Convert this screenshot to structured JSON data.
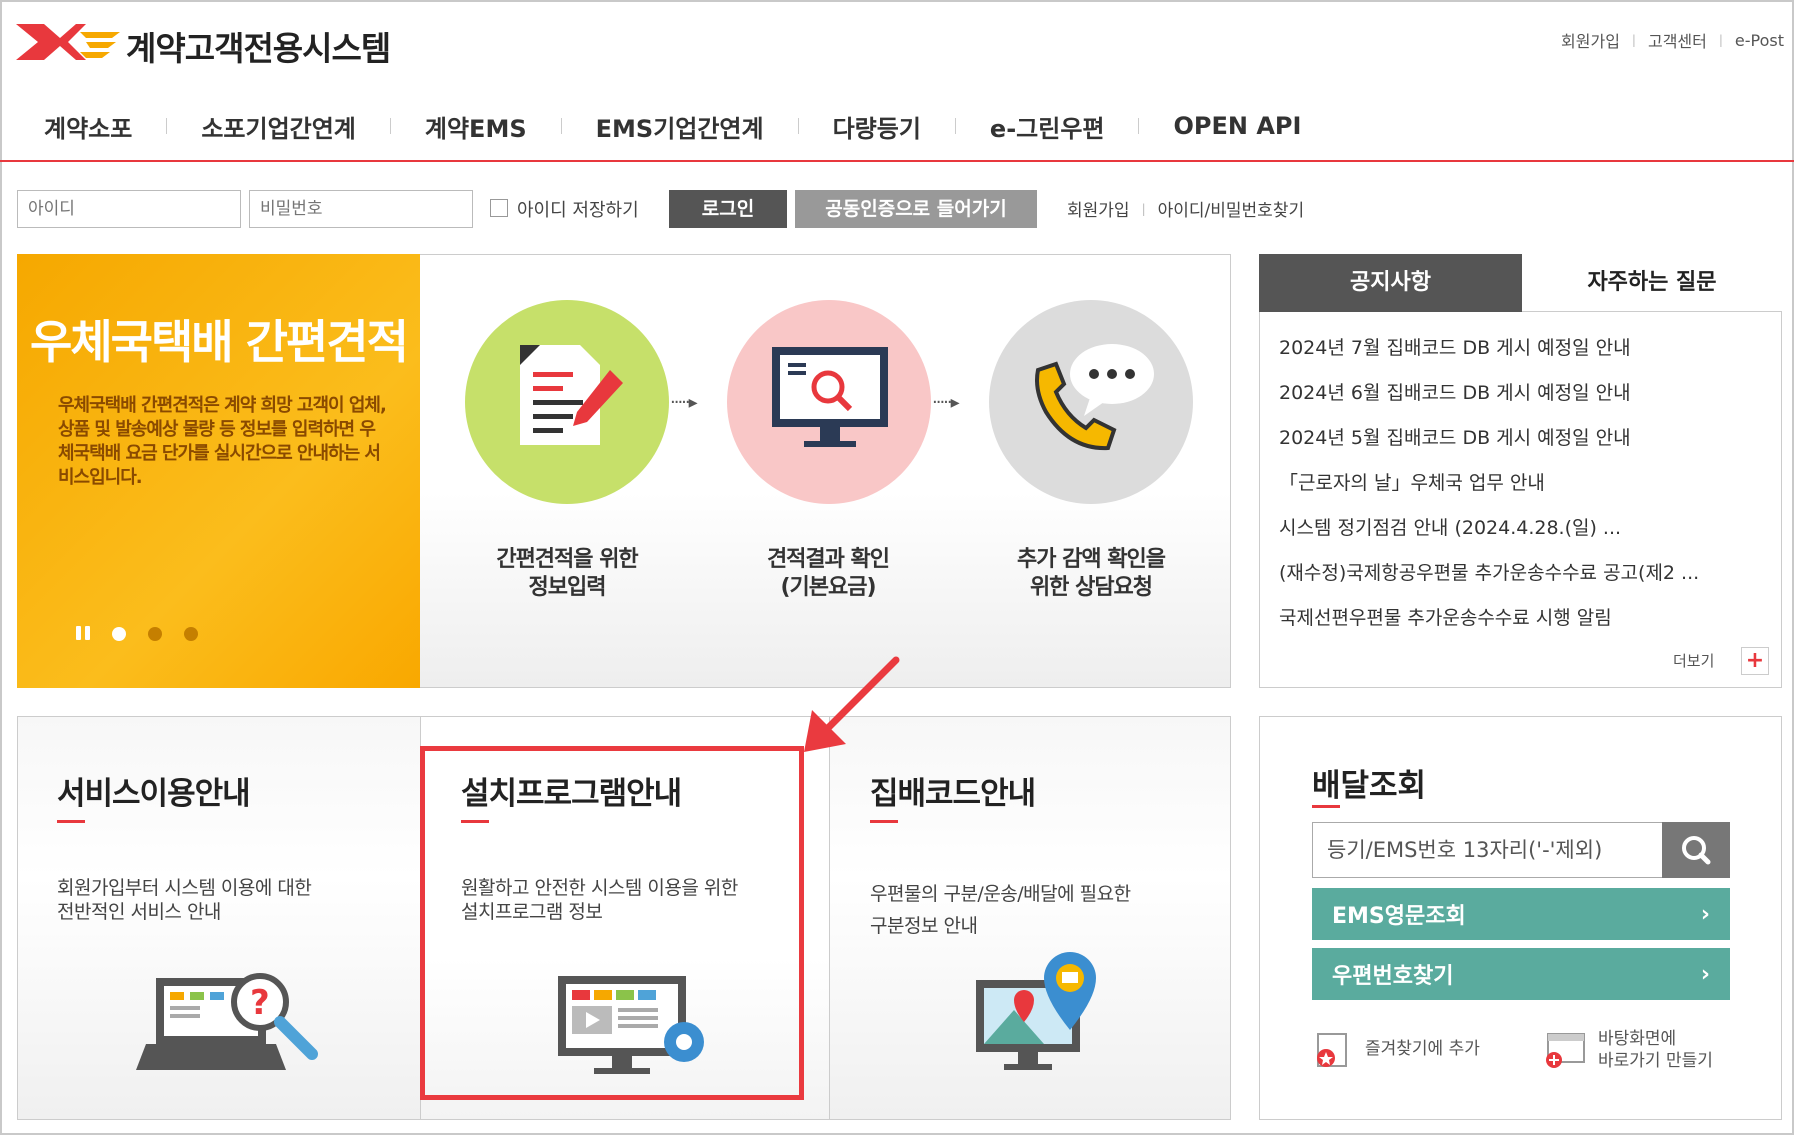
{
  "header": {
    "title": "계약고객전용시스템",
    "top_links": [
      "회원가입",
      "고객센터",
      "e-Post"
    ]
  },
  "nav": [
    "계약소포",
    "소포기업간연계",
    "계약EMS",
    "EMS기업간연계",
    "다량등기",
    "e-그린우편",
    "OPEN API"
  ],
  "login": {
    "id_placeholder": "아이디",
    "pw_placeholder": "비밀번호",
    "save_id_label": "아이디 저장하기",
    "login_label": "로그인",
    "cert_label": "공동인증으로 들어가기",
    "links": [
      "회원가입",
      "아이디/비밀번호찾기"
    ]
  },
  "banner": {
    "title": "우체국택배 간편견적",
    "desc": "우체국택배 간편견적은 계약 희망 고객이 업체, 상품 및 발송예상 물량 등 정보를 입력하면 우체국택배 요금 단가를 실시간으로 안내하는 서비스입니다.",
    "steps": [
      {
        "line1": "간편견적을 위한",
        "line2": "정보입력"
      },
      {
        "line1": "견적결과 확인",
        "line2": "(기본요금)"
      },
      {
        "line1": "추가 감액 확인을",
        "line2": "위한 상담요청"
      }
    ]
  },
  "notice": {
    "tab_active": "공지사항",
    "tab_inactive": "자주하는 질문",
    "items": [
      "2024년 7월 집배코드 DB 게시 예정일 안내",
      "2024년 6월 집배코드 DB 게시 예정일 안내",
      "2024년 5월 집배코드 DB 게시 예정일 안내",
      "「근로자의 날」우체국 업무 안내",
      "시스템 정기점검 안내 (2024.4.28.(일) ...",
      "(재수정)국제항공우편물 추가운송수수료 공고(제2 ...",
      "국제선편우편물 추가운송수수료 시행 알림"
    ],
    "more_label": "더보기",
    "plus_label": "+"
  },
  "cards": [
    {
      "title": "서비스이용안내",
      "desc1": "회원가입부터 시스템 이용에 대한",
      "desc2": "전반적인 서비스 안내"
    },
    {
      "title": "설치프로그램안내",
      "desc1": "원활하고 안전한 시스템 이용을 위한",
      "desc2": "설치프로그램 정보"
    },
    {
      "title": "집배코드안내",
      "desc1": "우편물의 구분/운송/배달에 필요한",
      "desc2": "구분정보 안내"
    }
  ],
  "delivery": {
    "title": "배달조회",
    "placeholder": "등기/EMS번호 13자리('-'제외)",
    "btn1": "EMS영문조회",
    "btn2": "우편번호찾기",
    "arrow": "›",
    "link1": "즐겨찾기에 추가",
    "link2a": "바탕화면에",
    "link2b": "바로가기 만들기"
  },
  "colors": {
    "accent": "#e8383d",
    "banner_orange": "#f9a800",
    "green_button": "#5aab9e",
    "highlight": "#ea3a3f"
  }
}
